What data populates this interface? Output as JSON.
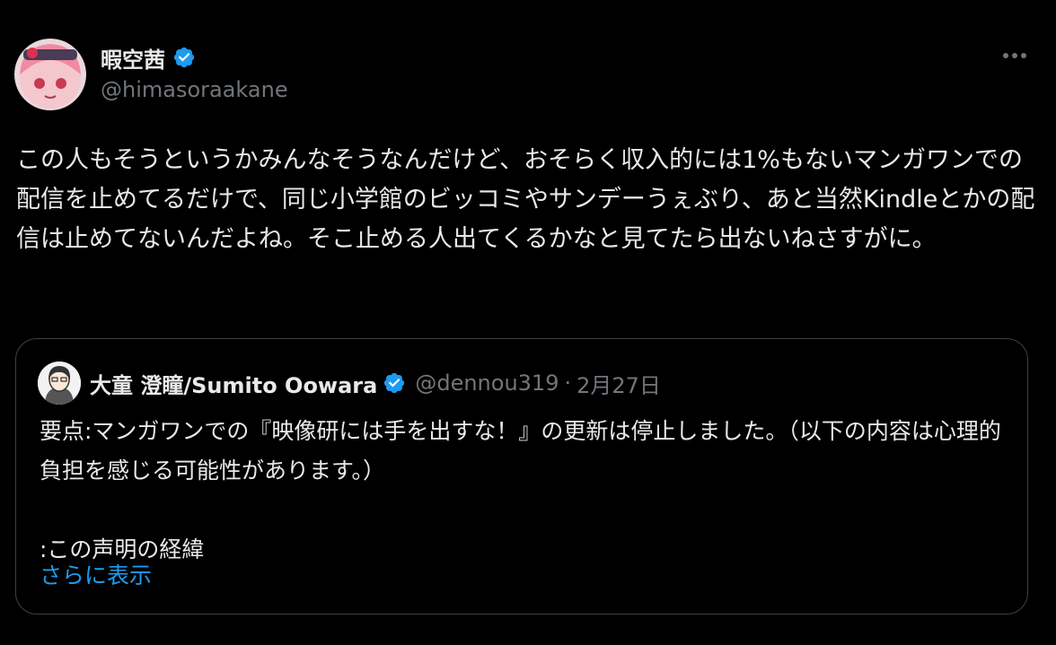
{
  "tweet": {
    "author": {
      "display_name": "暇空茜",
      "handle": "@himasoraakane",
      "verified": true
    },
    "more_icon": "more-horizontal-icon",
    "text": "この人もそうというかみんなそうなんだけど、おそらく収入的には1%もないマンガワンでの配信を止めてるだけで、同じ小学館のビッコミやサンデーうぇぶり、あと当然Kindleとかの配信は止めてないんだよね。そこ止める人出てくるかなと見てたら出ないねさすがに。"
  },
  "quote": {
    "author": {
      "display_name": "大童 澄瞳/Sumito Oowara",
      "handle": "@dennou319",
      "verified": true
    },
    "separator": "·",
    "date": "2月27日",
    "text": "要点:マンガワンでの『映像研には手を出すな！』の更新は停止しました。（以下の内容は心理的負担を感じる可能性があります。）\n\n:この声明の経緯",
    "show_more": "さらに表示"
  },
  "colors": {
    "background": "#000000",
    "text_primary": "#e7e9ea",
    "text_secondary": "#71767b",
    "link": "#1d9bf0",
    "verified": "#1d9bf0",
    "border": "#3e4144"
  }
}
